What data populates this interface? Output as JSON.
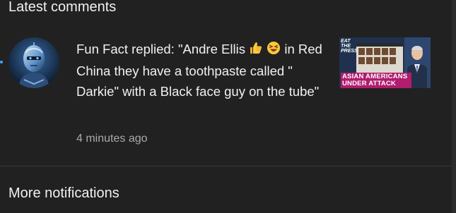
{
  "panel": {
    "latest_header": "Latest comments",
    "more_header": "More notifications"
  },
  "notification": {
    "text_before_emoji": "Fun Fact replied: \"Andre Ellis ",
    "emoji_1": "thumbs-up",
    "emoji_2": "laughing-face",
    "text_after_emoji": " in Red China they have a toothpaste called \" Darkie\" with a Black face guy on the tube\"",
    "timestamp": "4 minutes ago",
    "thumbnail": {
      "logo_line1": "EAT",
      "logo_line2": "THE",
      "logo_line3": "PRESS",
      "caption_line1": "ASIAN AMERICANS",
      "caption_line2": "UNDER ATTACK"
    }
  },
  "colors": {
    "background": "#212121",
    "text": "#f1f1f1",
    "secondary_text": "#aaaaaa",
    "unread_dot": "#3ea6ff",
    "caption_bg": "#b01c6e"
  }
}
